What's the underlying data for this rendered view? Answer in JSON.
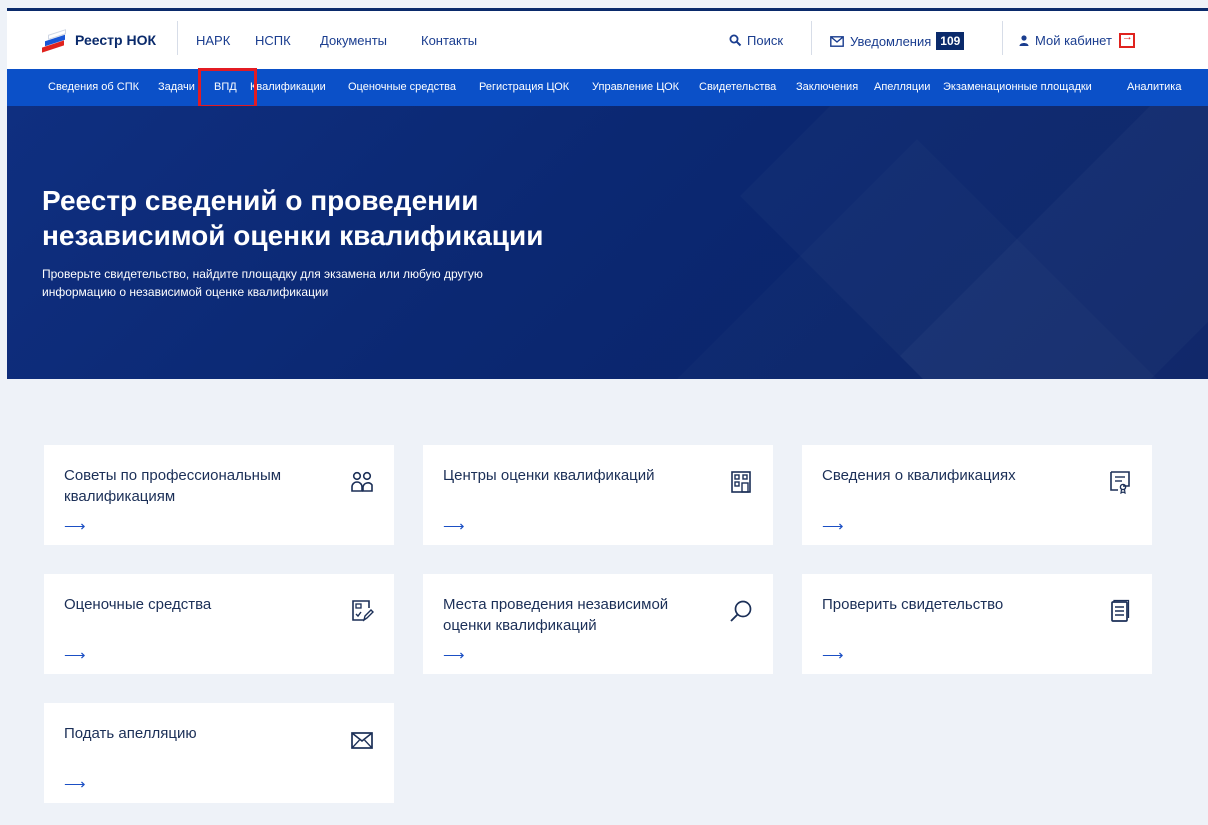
{
  "header": {
    "logo_text": "Реестр НОК",
    "nav": [
      "НАРК",
      "НСПК",
      "Документы",
      "Контакты"
    ],
    "search_label": "Поиск",
    "notifications_label": "Уведомления",
    "notifications_count": "109",
    "cabinet_label": "Мой кабинет"
  },
  "subnav": {
    "items": [
      "Сведения об СПК",
      "Задачи",
      "ВПД",
      "Квалификации",
      "Оценочные средства",
      "Регистрация ЦОК",
      "Управление ЦОК",
      "Свидетельства",
      "Заключения",
      "Апелляции",
      "Экзаменационные площадки",
      "Аналитика"
    ],
    "highlighted_item": "ВПД",
    "highlight_color": "#e31b23"
  },
  "hero": {
    "title_line1": "Реестр сведений о проведении",
    "title_line2": "независимой оценки квалификации",
    "subtitle_line1": "Проверьте свидетельство, найдите площадку для экзамена или любую другую",
    "subtitle_line2": "информацию о независимой оценке квалификации"
  },
  "cards": [
    {
      "title": "Советы по профессиональным квалификациям",
      "arrow": "⟶",
      "icon": "people-icon"
    },
    {
      "title": "Центры оценки квалификаций",
      "arrow": "⟶",
      "icon": "building-icon"
    },
    {
      "title": "Сведения о квалификациях",
      "arrow": "⟶",
      "icon": "certificate-icon"
    },
    {
      "title": "Оценочные средства",
      "arrow": "⟶",
      "icon": "document-edit-icon"
    },
    {
      "title": "Места проведения независимой оценки квалификаций",
      "arrow": "⟶",
      "icon": "search-icon"
    },
    {
      "title": "Проверить свидетельство",
      "arrow": "⟶",
      "icon": "document-icon"
    },
    {
      "title": "Подать апелляцию",
      "arrow": "⟶",
      "icon": "envelope-icon"
    }
  ],
  "colors": {
    "brand_dark": "#0a2a6b",
    "subnav_blue": "#0b50c8",
    "accent_red": "#e0231e",
    "page_bg": "#eef2f8"
  }
}
